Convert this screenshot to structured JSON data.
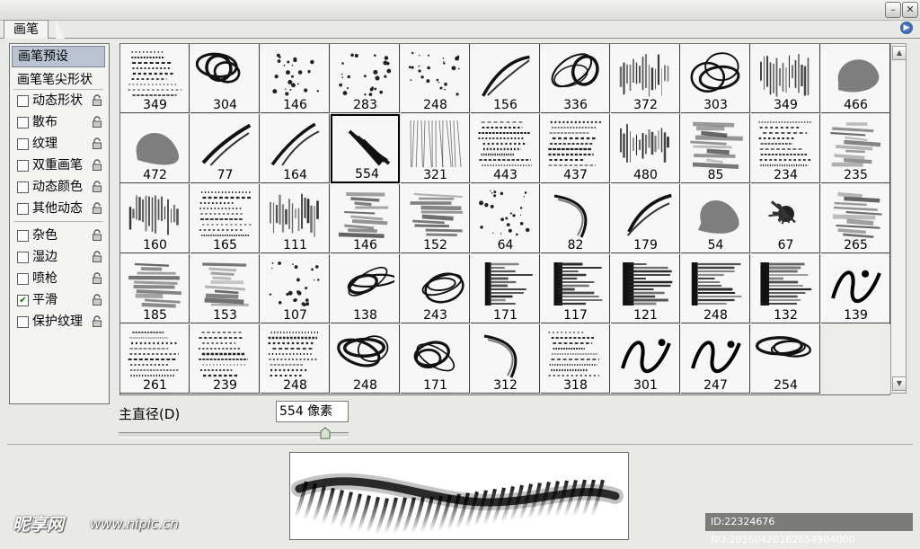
{
  "panel_tab": "画笔",
  "window_buttons": {
    "minimize": "–",
    "close": "✕"
  },
  "sidebar": {
    "header": "画笔预设",
    "tip_shape": "画笔笔尖形状",
    "options": [
      {
        "label": "动态形状",
        "checked": false
      },
      {
        "label": "散布",
        "checked": false
      },
      {
        "label": "纹理",
        "checked": false
      },
      {
        "label": "双重画笔",
        "checked": false
      },
      {
        "label": "动态颜色",
        "checked": false
      },
      {
        "label": "其他动态",
        "checked": false
      },
      {
        "label": "杂色",
        "checked": false
      },
      {
        "label": "湿边",
        "checked": false
      },
      {
        "label": "喷枪",
        "checked": false
      },
      {
        "label": "平滑",
        "checked": true
      },
      {
        "label": "保护纹理",
        "checked": false
      }
    ]
  },
  "brushes": {
    "selected_index": 14,
    "items": [
      {
        "size": "349",
        "style": "text"
      },
      {
        "size": "304",
        "style": "swirl"
      },
      {
        "size": "146",
        "style": "dots"
      },
      {
        "size": "283",
        "style": "dots"
      },
      {
        "size": "248",
        "style": "dots"
      },
      {
        "size": "156",
        "style": "stroke"
      },
      {
        "size": "336",
        "style": "swirl"
      },
      {
        "size": "372",
        "style": "bars"
      },
      {
        "size": "303",
        "style": "swirl"
      },
      {
        "size": "349",
        "style": "bars"
      },
      {
        "size": "466",
        "style": "blob"
      },
      {
        "size": "472",
        "style": "blob"
      },
      {
        "size": "77",
        "style": "stroke"
      },
      {
        "size": "164",
        "style": "stroke"
      },
      {
        "size": "554",
        "style": "feather"
      },
      {
        "size": "321",
        "style": "hatch"
      },
      {
        "size": "443",
        "style": "text"
      },
      {
        "size": "437",
        "style": "text"
      },
      {
        "size": "480",
        "style": "bars"
      },
      {
        "size": "85",
        "style": "streak"
      },
      {
        "size": "234",
        "style": "text"
      },
      {
        "size": "235",
        "style": "streak"
      },
      {
        "size": "160",
        "style": "bars"
      },
      {
        "size": "165",
        "style": "text"
      },
      {
        "size": "111",
        "style": "bars"
      },
      {
        "size": "146",
        "style": "streak"
      },
      {
        "size": "152",
        "style": "streak"
      },
      {
        "size": "64",
        "style": "dots"
      },
      {
        "size": "82",
        "style": "arc"
      },
      {
        "size": "179",
        "style": "stroke"
      },
      {
        "size": "54",
        "style": "blob"
      },
      {
        "size": "67",
        "style": "splat"
      },
      {
        "size": "265",
        "style": "streak"
      },
      {
        "size": "185",
        "style": "streak"
      },
      {
        "size": "153",
        "style": "streak"
      },
      {
        "size": "107",
        "style": "dots"
      },
      {
        "size": "138",
        "style": "swirl"
      },
      {
        "size": "243",
        "style": "swirl"
      },
      {
        "size": "171",
        "style": "fan"
      },
      {
        "size": "117",
        "style": "fan"
      },
      {
        "size": "121",
        "style": "fan"
      },
      {
        "size": "248",
        "style": "fan"
      },
      {
        "size": "132",
        "style": "fan"
      },
      {
        "size": "139",
        "style": "script"
      },
      {
        "size": "261",
        "style": "text"
      },
      {
        "size": "239",
        "style": "text"
      },
      {
        "size": "248",
        "style": "text"
      },
      {
        "size": "248",
        "style": "swirl"
      },
      {
        "size": "171",
        "style": "swirl"
      },
      {
        "size": "312",
        "style": "arc"
      },
      {
        "size": "318",
        "style": "text"
      },
      {
        "size": "301",
        "style": "script"
      },
      {
        "size": "247",
        "style": "script"
      },
      {
        "size": "254",
        "style": "swirl"
      },
      {
        "size": "",
        "style": "empty"
      }
    ]
  },
  "master_diameter": {
    "label": "主直径(D)",
    "value": "554 像素",
    "slider_fraction": 0.9
  },
  "watermark": {
    "logo": "昵享网",
    "url": "www.nipic.cn",
    "id_text": "ID:22324676 NO:20160420162654904000"
  }
}
